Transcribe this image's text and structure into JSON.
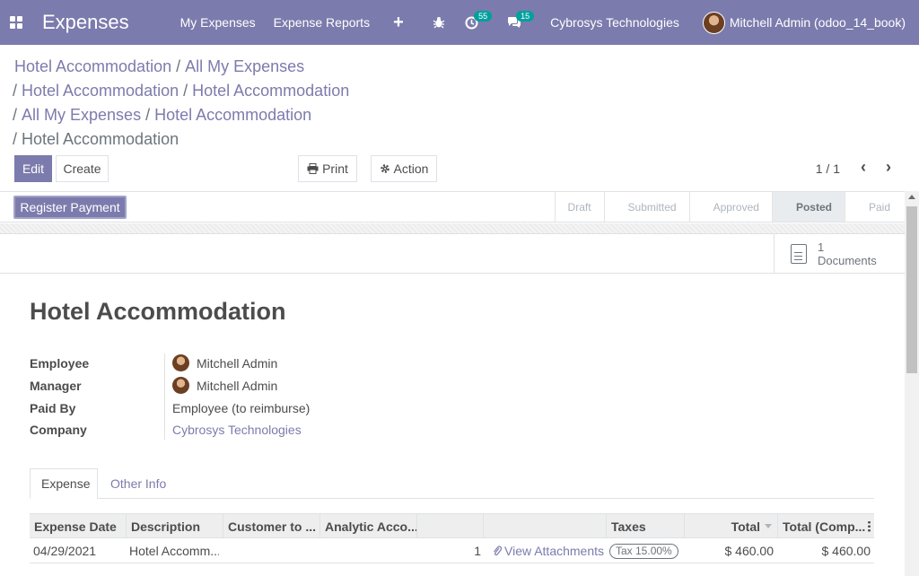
{
  "navbar": {
    "app_name": "Expenses",
    "menu": [
      "My Expenses",
      "Expense Reports"
    ],
    "plus_label": "+",
    "bug_icon": "bug-icon",
    "activity_count": "55",
    "message_count": "15",
    "company": "Cybrosys Technologies",
    "user": "Mitchell Admin (odoo_14_book)",
    "color": "#7c7bad"
  },
  "breadcrumbs": {
    "items": [
      "Hotel Accommodation",
      "All My Expenses",
      "Hotel Accommodation",
      "Hotel Accommodation",
      "All My Expenses",
      "Hotel Accommodation",
      "Hotel Accommodation"
    ],
    "separator": "/"
  },
  "controls": {
    "edit": "Edit",
    "create": "Create",
    "print": "Print",
    "action": "Action",
    "pager": "1 / 1"
  },
  "statusbar": {
    "register_payment": "Register Payment",
    "stages": [
      "Draft",
      "Submitted",
      "Approved",
      "Posted",
      "Paid"
    ],
    "active_stage": "Posted"
  },
  "smart_button": {
    "count": "1",
    "label": "Documents"
  },
  "record": {
    "title": "Hotel Accommodation",
    "fields": [
      {
        "label": "Employee",
        "value": "Mitchell Admin"
      },
      {
        "label": "Manager",
        "value": "Mitchell Admin"
      },
      {
        "label": "Paid By",
        "value": "Employee (to reimburse)"
      },
      {
        "label": "Company",
        "value": "Cybrosys Technologies"
      }
    ]
  },
  "tabs": [
    "Expense",
    "Other Info"
  ],
  "table": {
    "columns": [
      "Expense Date",
      "Description",
      "Customer to ...",
      "Analytic Acco...",
      "",
      "",
      "Taxes",
      "Total",
      "Total (Comp..."
    ],
    "rows": [
      {
        "date": "04/29/2021",
        "description": "Hotel Accomm...",
        "customer": "",
        "analytic": "",
        "quantity": "1",
        "attachments": "View Attachments",
        "taxes": "Tax 15.00%",
        "total": "$ 460.00",
        "total_company": "$ 460.00"
      }
    ]
  }
}
